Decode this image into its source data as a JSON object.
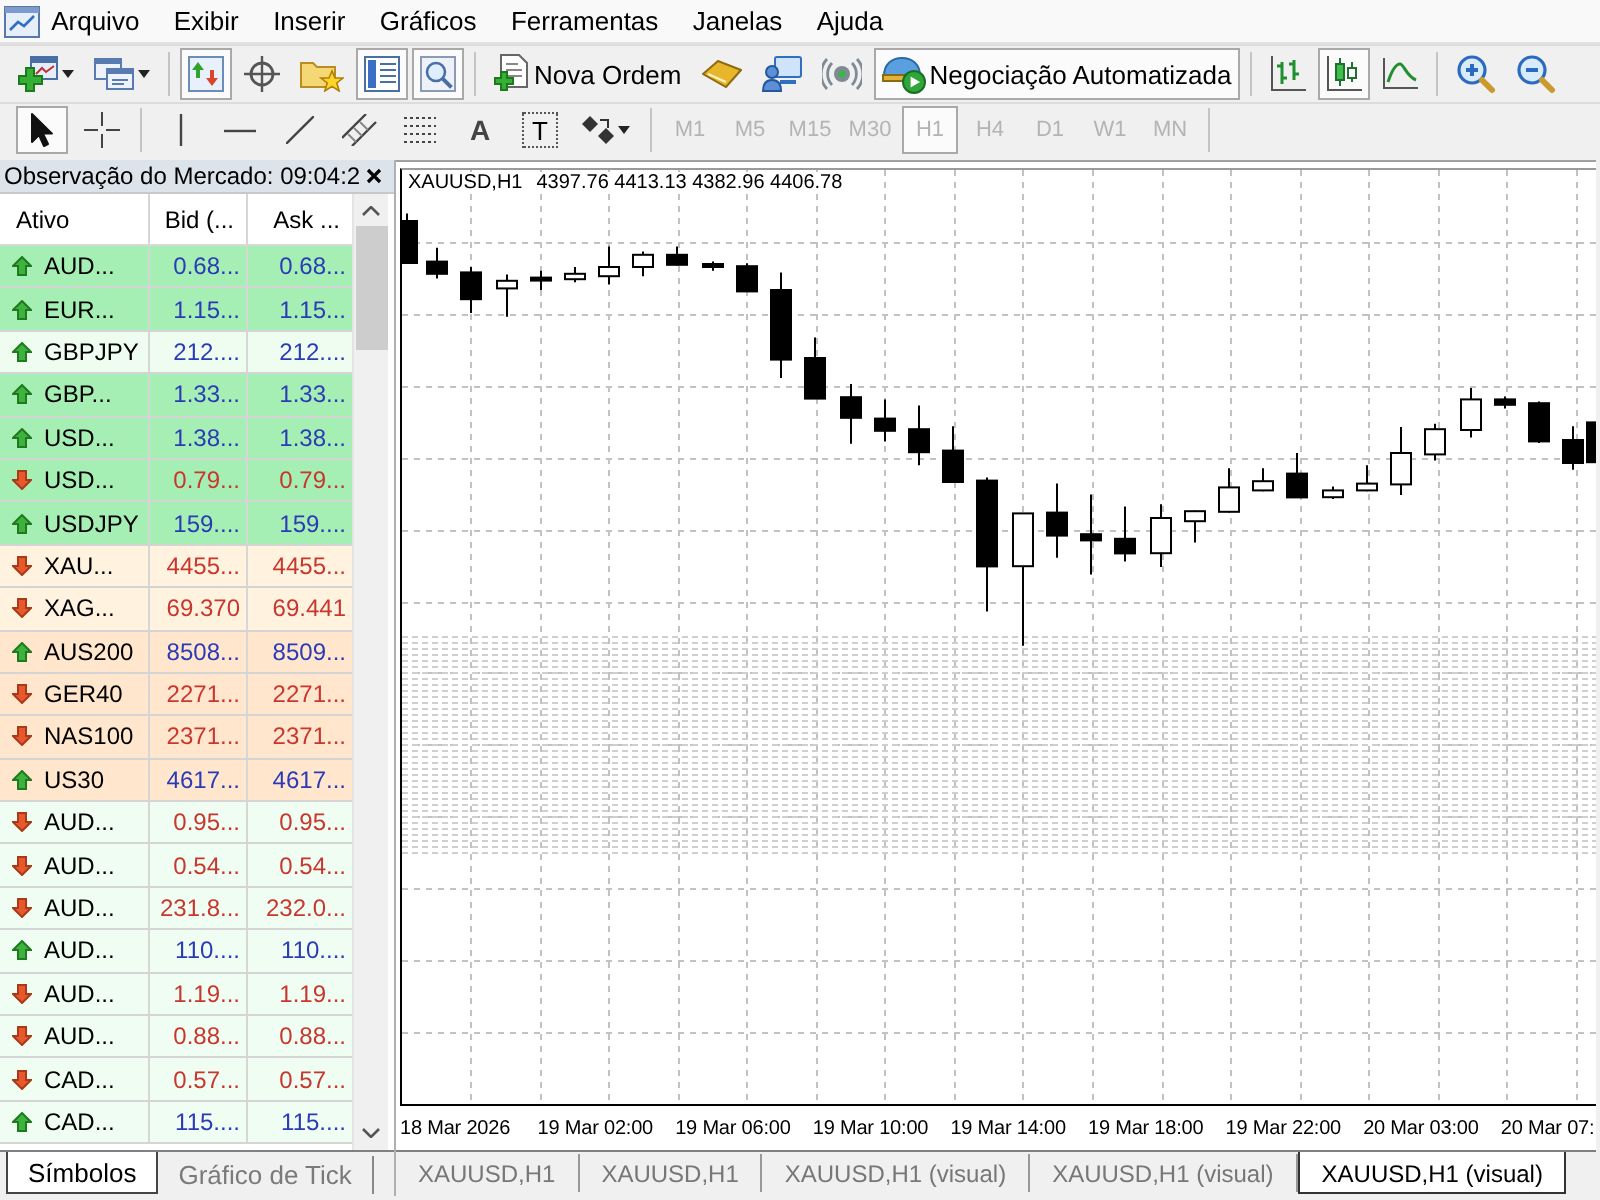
{
  "menu": [
    "Arquivo",
    "Exibir",
    "Inserir",
    "Gráficos",
    "Ferramentas",
    "Janelas",
    "Ajuda"
  ],
  "toolbar": {
    "groups": [
      [
        {
          "pressed": false
        },
        {
          "pressed": false
        }
      ],
      [
        {
          "pressed": true
        },
        {
          "pressed": false
        },
        {
          "pressed": false
        },
        {
          "pressed": true
        },
        {
          "pressed": true
        }
      ],
      [
        {
          "label": "Nova Ordem",
          "pressed": false
        },
        {
          "pressed": false
        },
        {
          "pressed": false
        },
        {
          "pressed": false
        },
        {
          "label": "Negociação Automatizada",
          "pressed": true
        }
      ],
      [
        {
          "pressed": false
        },
        {
          "pressed": true
        },
        {
          "pressed": false
        }
      ],
      [
        {
          "pressed": false
        },
        {
          "pressed": false
        }
      ]
    ]
  },
  "drawing_toolbar": {
    "groups": [
      [
        {
          "pressed": true
        },
        {
          "pressed": false
        }
      ],
      [
        {
          "pressed": false
        },
        {
          "pressed": false
        },
        {
          "pressed": false
        },
        {
          "pressed": false
        },
        {
          "pressed": false
        },
        {
          "glyph": "A",
          "pressed": false
        },
        {
          "glyph": "T",
          "pressed": false
        },
        {
          "pressed": false
        }
      ]
    ]
  },
  "timeframes": [
    {
      "label": "M1",
      "selected": false,
      "disabled": true
    },
    {
      "label": "M5",
      "selected": false,
      "disabled": true
    },
    {
      "label": "M15",
      "selected": false,
      "disabled": true
    },
    {
      "label": "M30",
      "selected": false,
      "disabled": true
    },
    {
      "label": "H1",
      "selected": true,
      "disabled": true
    },
    {
      "label": "H4",
      "selected": false,
      "disabled": true
    },
    {
      "label": "D1",
      "selected": false,
      "disabled": true
    },
    {
      "label": "W1",
      "selected": false,
      "disabled": true
    },
    {
      "label": "MN",
      "selected": false,
      "disabled": true
    }
  ],
  "market_watch": {
    "title": "Observação do Mercado: 09:04:2",
    "columns": [
      "Ativo",
      "Bid (...",
      "Ask ..."
    ],
    "rows": [
      {
        "symbol": "AUD...",
        "bid": "0.68...",
        "ask": "0.68...",
        "rising": true,
        "color": "#a6efb4"
      },
      {
        "symbol": "EUR...",
        "bid": "1.15...",
        "ask": "1.15...",
        "rising": true,
        "color": "#a6efb4"
      },
      {
        "symbol": "GBPJPY",
        "bid": "212....",
        "ask": "212....",
        "rising": true,
        "color": "#eefdf0"
      },
      {
        "symbol": "GBP...",
        "bid": "1.33...",
        "ask": "1.33...",
        "rising": true,
        "color": "#a6efb4"
      },
      {
        "symbol": "USD...",
        "bid": "1.38...",
        "ask": "1.38...",
        "rising": true,
        "color": "#a6efb4"
      },
      {
        "symbol": "USD...",
        "bid": "0.79...",
        "ask": "0.79...",
        "rising": false,
        "color": "#a6efb4"
      },
      {
        "symbol": "USDJPY",
        "bid": "159....",
        "ask": "159....",
        "rising": true,
        "color": "#a6efb4"
      },
      {
        "symbol": "XAU...",
        "bid": "4455...",
        "ask": "4455...",
        "rising": false,
        "color": "#fff3df"
      },
      {
        "symbol": "XAG...",
        "bid": "69.370",
        "ask": "69.441",
        "rising": false,
        "color": "#fff3df"
      },
      {
        "symbol": "AUS200",
        "bid": "8508...",
        "ask": "8509...",
        "rising": true,
        "color": "#ffe6cc"
      },
      {
        "symbol": "GER40",
        "bid": "2271...",
        "ask": "2271...",
        "rising": false,
        "color": "#ffe6cc"
      },
      {
        "symbol": "NAS100",
        "bid": "2371...",
        "ask": "2371...",
        "rising": false,
        "color": "#ffe6cc"
      },
      {
        "symbol": "US30",
        "bid": "4617...",
        "ask": "4617...",
        "rising": true,
        "color": "#ffe6cc"
      },
      {
        "symbol": "AUD...",
        "bid": "0.95...",
        "ask": "0.95...",
        "rising": false,
        "color": "#effdf3"
      },
      {
        "symbol": "AUD...",
        "bid": "0.54...",
        "ask": "0.54...",
        "rising": false,
        "color": "#effdf3"
      },
      {
        "symbol": "AUD...",
        "bid": "231.8...",
        "ask": "232.0...",
        "rising": false,
        "color": "#effdf3"
      },
      {
        "symbol": "AUD...",
        "bid": "110....",
        "ask": "110....",
        "rising": true,
        "color": "#effdf3"
      },
      {
        "symbol": "AUD...",
        "bid": "1.19...",
        "ask": "1.19...",
        "rising": false,
        "color": "#effdf3"
      },
      {
        "symbol": "AUD...",
        "bid": "0.88...",
        "ask": "0.88...",
        "rising": false,
        "color": "#effdf3"
      },
      {
        "symbol": "CAD...",
        "bid": "0.57...",
        "ask": "0.57...",
        "rising": false,
        "color": "#effdf3"
      },
      {
        "symbol": "CAD...",
        "bid": "115....",
        "ask": "115....",
        "rising": true,
        "color": "#effdf3"
      }
    ],
    "tabs": [
      {
        "label": "Símbolos",
        "selected": true
      },
      {
        "label": "Gráfico de Tick",
        "selected": false
      }
    ]
  },
  "chart": {
    "symbol": "XAUUSD,H1",
    "ohlc": "4397.76 4413.13 4382.96 4406.78",
    "time_labels": [
      "18 Mar 2026",
      "19 Mar 02:00",
      "19 Mar 06:00",
      "19 Mar 10:00",
      "19 Mar 14:00",
      "19 Mar 18:00",
      "19 Mar 22:00",
      "20 Mar 03:00",
      "20 Mar 07:"
    ]
  },
  "chart_tabs": [
    {
      "label": "XAUUSD,H1",
      "selected": false
    },
    {
      "label": "XAUUSD,H1",
      "selected": false
    },
    {
      "label": "XAUUSD,H1 (visual)",
      "selected": false
    },
    {
      "label": "XAUUSD,H1 (visual)",
      "selected": false
    },
    {
      "label": "XAUUSD,H1 (visual)",
      "selected": true
    }
  ]
}
